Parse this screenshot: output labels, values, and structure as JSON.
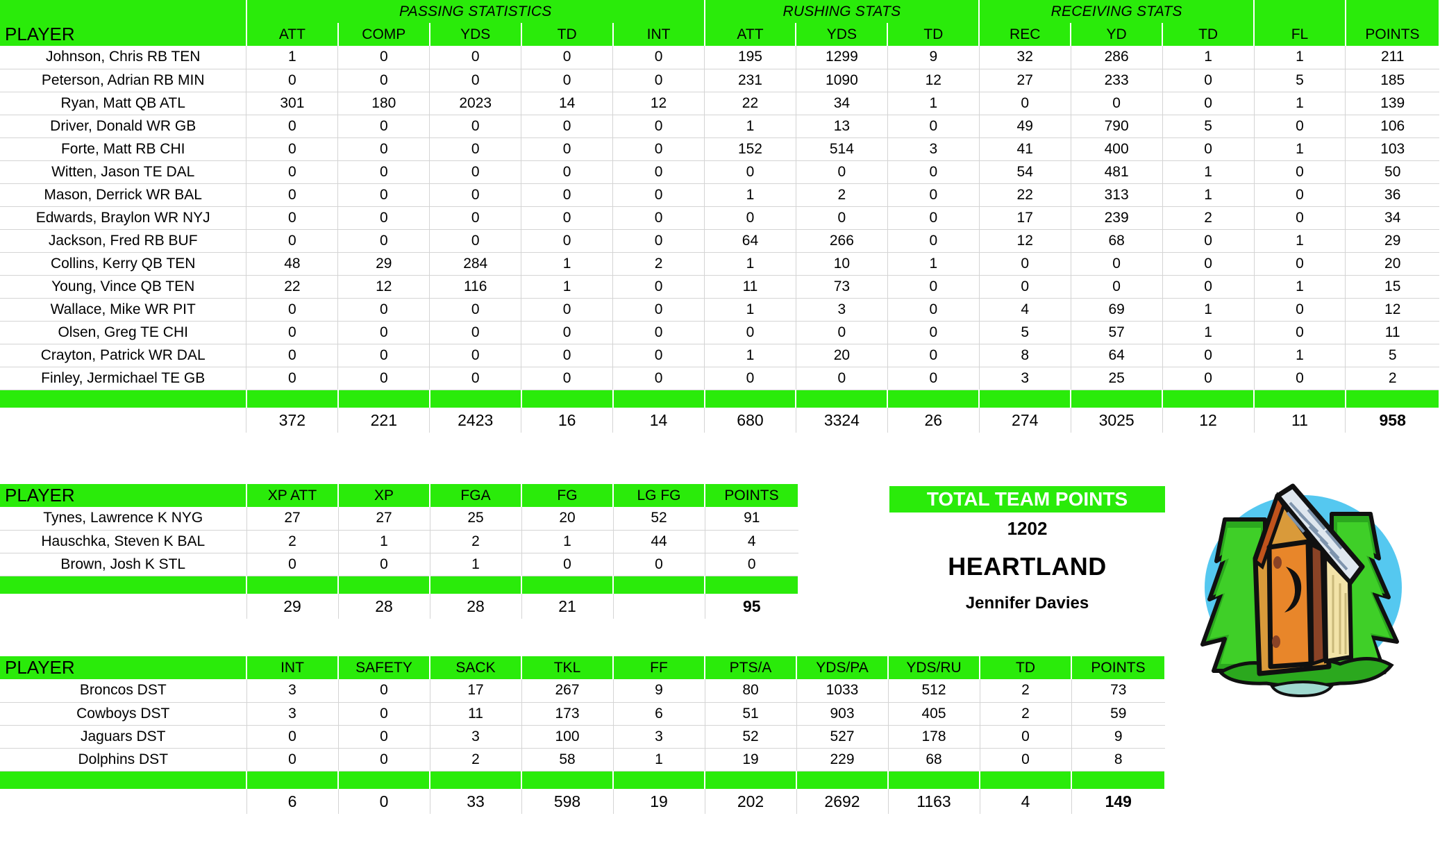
{
  "offense": {
    "group_headers": [
      {
        "label": "",
        "span": 1
      },
      {
        "label": "PASSING STATISTICS",
        "span": 5
      },
      {
        "label": "RUSHING STATS",
        "span": 3
      },
      {
        "label": "RECEIVING STATS",
        "span": 3
      },
      {
        "label": "",
        "span": 1
      },
      {
        "label": "",
        "span": 1
      }
    ],
    "columns": [
      "PLAYER",
      "ATT",
      "COMP",
      "YDS",
      "TD",
      "INT",
      "ATT",
      "YDS",
      "TD",
      "REC",
      "YD",
      "TD",
      "FL",
      "POINTS"
    ],
    "rows": [
      {
        "player": "Johnson, Chris RB TEN",
        "values": [
          "1",
          "0",
          "0",
          "0",
          "0",
          "195",
          "1299",
          "9",
          "32",
          "286",
          "1",
          "1",
          "211"
        ]
      },
      {
        "player": "Peterson, Adrian RB MIN",
        "values": [
          "0",
          "0",
          "0",
          "0",
          "0",
          "231",
          "1090",
          "12",
          "27",
          "233",
          "0",
          "5",
          "185"
        ]
      },
      {
        "player": "Ryan, Matt QB ATL",
        "values": [
          "301",
          "180",
          "2023",
          "14",
          "12",
          "22",
          "34",
          "1",
          "0",
          "0",
          "0",
          "1",
          "139"
        ]
      },
      {
        "player": "Driver, Donald WR GB",
        "values": [
          "0",
          "0",
          "0",
          "0",
          "0",
          "1",
          "13",
          "0",
          "49",
          "790",
          "5",
          "0",
          "106"
        ]
      },
      {
        "player": "Forte, Matt RB CHI",
        "values": [
          "0",
          "0",
          "0",
          "0",
          "0",
          "152",
          "514",
          "3",
          "41",
          "400",
          "0",
          "1",
          "103"
        ]
      },
      {
        "player": "Witten, Jason TE DAL",
        "values": [
          "0",
          "0",
          "0",
          "0",
          "0",
          "0",
          "0",
          "0",
          "54",
          "481",
          "1",
          "0",
          "50"
        ]
      },
      {
        "player": "Mason, Derrick WR BAL",
        "values": [
          "0",
          "0",
          "0",
          "0",
          "0",
          "1",
          "2",
          "0",
          "22",
          "313",
          "1",
          "0",
          "36"
        ]
      },
      {
        "player": "Edwards, Braylon WR NYJ",
        "values": [
          "0",
          "0",
          "0",
          "0",
          "0",
          "0",
          "0",
          "0",
          "17",
          "239",
          "2",
          "0",
          "34"
        ]
      },
      {
        "player": "Jackson, Fred RB BUF",
        "values": [
          "0",
          "0",
          "0",
          "0",
          "0",
          "64",
          "266",
          "0",
          "12",
          "68",
          "0",
          "1",
          "29"
        ]
      },
      {
        "player": "Collins, Kerry QB TEN",
        "values": [
          "48",
          "29",
          "284",
          "1",
          "2",
          "1",
          "10",
          "1",
          "0",
          "0",
          "0",
          "0",
          "20"
        ]
      },
      {
        "player": "Young, Vince QB TEN",
        "values": [
          "22",
          "12",
          "116",
          "1",
          "0",
          "11",
          "73",
          "0",
          "0",
          "0",
          "0",
          "1",
          "15"
        ]
      },
      {
        "player": "Wallace, Mike WR PIT",
        "values": [
          "0",
          "0",
          "0",
          "0",
          "0",
          "1",
          "3",
          "0",
          "4",
          "69",
          "1",
          "0",
          "12"
        ]
      },
      {
        "player": "Olsen, Greg TE CHI",
        "values": [
          "0",
          "0",
          "0",
          "0",
          "0",
          "0",
          "0",
          "0",
          "5",
          "57",
          "1",
          "0",
          "11"
        ]
      },
      {
        "player": "Crayton, Patrick WR DAL",
        "values": [
          "0",
          "0",
          "0",
          "0",
          "0",
          "1",
          "20",
          "0",
          "8",
          "64",
          "0",
          "1",
          "5"
        ]
      },
      {
        "player": "Finley, Jermichael TE GB",
        "values": [
          "0",
          "0",
          "0",
          "0",
          "0",
          "0",
          "0",
          "0",
          "3",
          "25",
          "0",
          "0",
          "2"
        ]
      }
    ],
    "totals": [
      "372",
      "221",
      "2423",
      "16",
      "14",
      "680",
      "3324",
      "26",
      "274",
      "3025",
      "12",
      "11",
      "958"
    ]
  },
  "kickers": {
    "columns": [
      "PLAYER",
      "XP ATT",
      "XP",
      "FGA",
      "FG",
      "LG FG",
      "POINTS"
    ],
    "rows": [
      {
        "player": "Tynes, Lawrence K NYG",
        "values": [
          "27",
          "27",
          "25",
          "20",
          "52",
          "91"
        ]
      },
      {
        "player": "Hauschka, Steven K BAL",
        "values": [
          "2",
          "1",
          "2",
          "1",
          "44",
          "4"
        ]
      },
      {
        "player": "Brown, Josh K STL",
        "values": [
          "0",
          "0",
          "1",
          "0",
          "0",
          "0"
        ]
      }
    ],
    "totals": [
      "29",
      "28",
      "28",
      "21",
      "",
      "95"
    ]
  },
  "defense": {
    "columns": [
      "PLAYER",
      "INT",
      "SAFETY",
      "SACK",
      "TKL",
      "FF",
      "PTS/A",
      "YDS/PA",
      "YDS/RU",
      "TD",
      "POINTS"
    ],
    "rows": [
      {
        "player": "Broncos DST",
        "values": [
          "3",
          "0",
          "17",
          "267",
          "9",
          "80",
          "1033",
          "512",
          "2",
          "73"
        ]
      },
      {
        "player": "Cowboys DST",
        "values": [
          "3",
          "0",
          "11",
          "173",
          "6",
          "51",
          "903",
          "405",
          "2",
          "59"
        ]
      },
      {
        "player": "Jaguars DST",
        "values": [
          "0",
          "0",
          "3",
          "100",
          "3",
          "52",
          "527",
          "178",
          "0",
          "9"
        ]
      },
      {
        "player": "Dolphins DST",
        "values": [
          "0",
          "0",
          "2",
          "58",
          "1",
          "19",
          "229",
          "68",
          "0",
          "8"
        ]
      }
    ],
    "totals": [
      "6",
      "0",
      "33",
      "598",
      "19",
      "202",
      "2692",
      "1163",
      "4",
      "149"
    ]
  },
  "team_panel": {
    "header": "TOTAL TEAM POINTS",
    "points": "1202",
    "team_name": "HEARTLAND",
    "owner": "Jennifer Davies"
  },
  "theme": {
    "green": "#2aeb0a",
    "header_text": "#ffffff",
    "body_text": "#000000",
    "grid_line": "#d4d4d4"
  }
}
